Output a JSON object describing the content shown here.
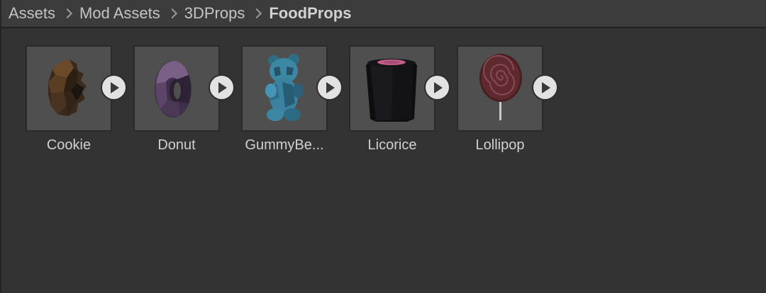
{
  "breadcrumb": {
    "items": [
      {
        "label": "Assets"
      },
      {
        "label": "Mod Assets"
      },
      {
        "label": "3DProps"
      },
      {
        "label": "FoodProps"
      }
    ]
  },
  "assets": [
    {
      "label": "Cookie",
      "icon": "cookie-icon"
    },
    {
      "label": "Donut",
      "icon": "donut-icon"
    },
    {
      "label": "GummyBe...",
      "icon": "gummy-bear-icon"
    },
    {
      "label": "Licorice",
      "icon": "licorice-icon"
    },
    {
      "label": "Lollipop",
      "icon": "lollipop-icon"
    }
  ],
  "colors": {
    "background": "#333333",
    "header": "#3c3c3c",
    "thumbnail": "#4f4f4f",
    "text": "#d0d0d0"
  }
}
